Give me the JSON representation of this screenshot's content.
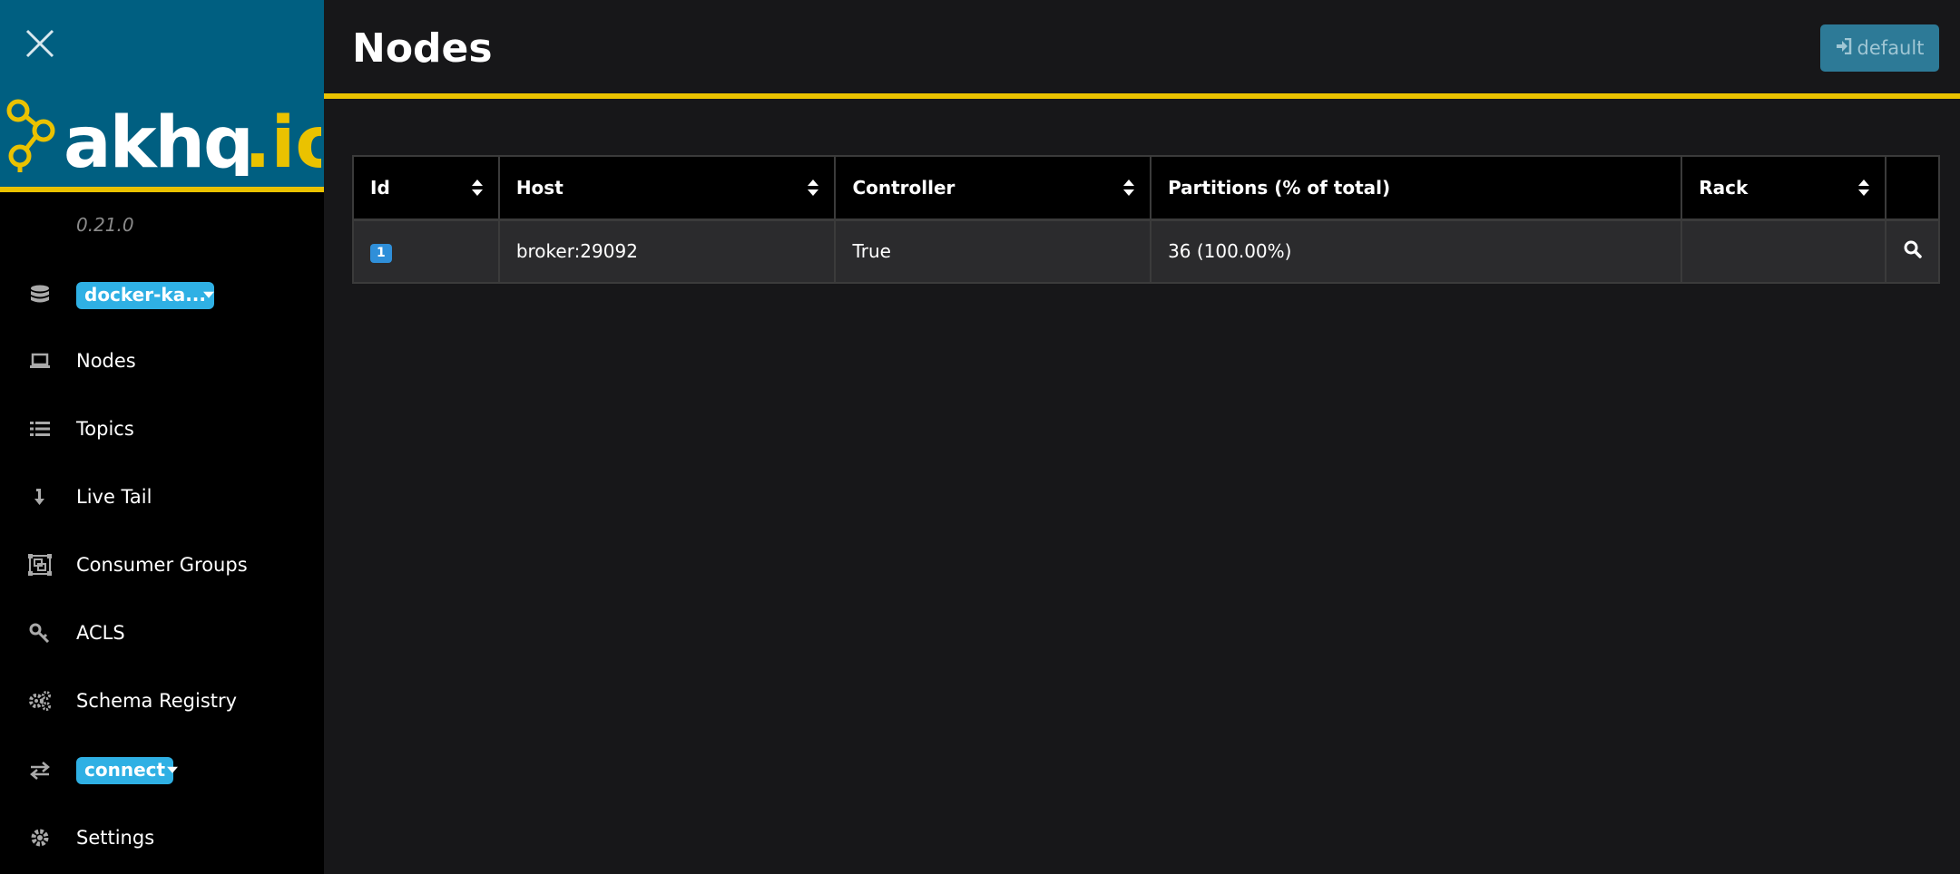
{
  "sidebar": {
    "logo_text": "akhq.io",
    "version": "0.21.0",
    "cluster_badge": "docker-ka...",
    "items": [
      {
        "label": "Nodes",
        "icon": "laptop-icon"
      },
      {
        "label": "Topics",
        "icon": "list-icon"
      },
      {
        "label": "Live Tail",
        "icon": "arrow-down-icon"
      },
      {
        "label": "Consumer Groups",
        "icon": "object-group-icon"
      },
      {
        "label": "ACLS",
        "icon": "key-icon"
      },
      {
        "label": "Schema Registry",
        "icon": "cogs-icon"
      }
    ],
    "connect_badge": "connect",
    "settings_label": "Settings"
  },
  "header": {
    "title": "Nodes",
    "user_button": "default"
  },
  "table": {
    "columns": [
      "Id",
      "Host",
      "Controller",
      "Partitions (% of total)",
      "Rack"
    ],
    "rows": [
      {
        "id": "1",
        "host": "broker:29092",
        "controller": "True",
        "partitions": "36 (100.00%)",
        "rack": ""
      }
    ]
  },
  "colors": {
    "brand_blue": "#005f81",
    "accent_yellow": "#eac200",
    "badge_blue": "#2fb0e4"
  }
}
